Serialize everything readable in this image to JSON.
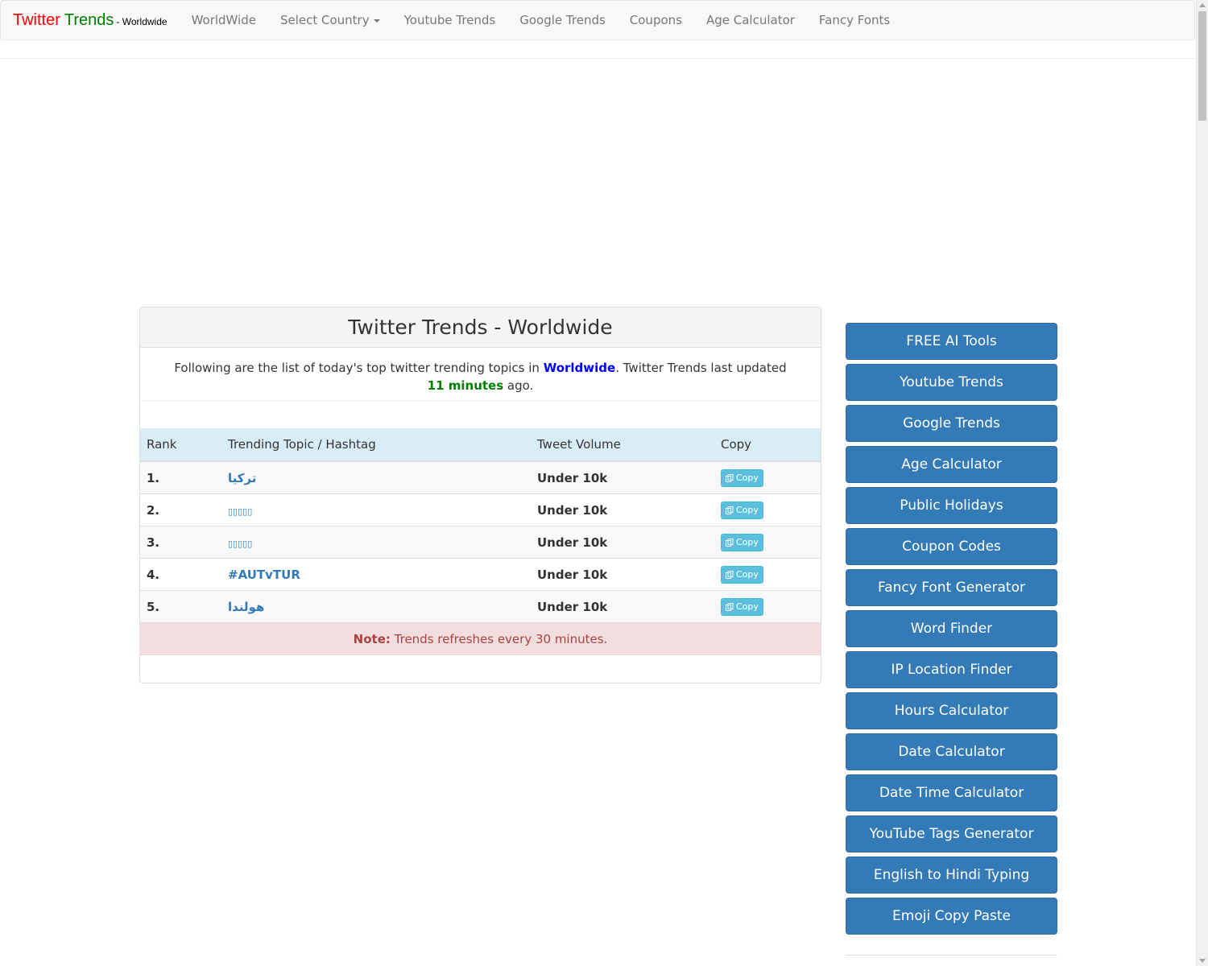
{
  "navbar": {
    "brand_part1": "Twitter",
    "brand_part2": "Trends",
    "brand_suffix": "- Worldwide",
    "items": [
      "WorldWide",
      "Select Country",
      "Youtube Trends",
      "Google Trends",
      "Coupons",
      "Age Calculator",
      "Fancy Fonts"
    ]
  },
  "panel": {
    "title": "Twitter Trends - Worldwide",
    "intro_pre": "Following are the list of today's top twitter trending topics in ",
    "intro_country": "Worldwide",
    "intro_mid": ". Twitter Trends last updated ",
    "intro_updated": "11 minutes",
    "intro_post": " ago."
  },
  "table": {
    "headers": [
      "Rank",
      "Trending Topic / Hashtag",
      "Tweet Volume",
      "Copy"
    ],
    "rows": [
      {
        "rank": "1.",
        "topic": "تركيا",
        "volume": "Under 10k",
        "copy": "Copy"
      },
      {
        "rank": "2.",
        "topic": "▯▯▯▯▯",
        "volume": "Under 10k",
        "copy": "Copy"
      },
      {
        "rank": "3.",
        "topic": "▯▯▯▯▯",
        "volume": "Under 10k",
        "copy": "Copy"
      },
      {
        "rank": "4.",
        "topic": "#AUTvTUR",
        "volume": "Under 10k",
        "copy": "Copy"
      },
      {
        "rank": "5.",
        "topic": "هولندا",
        "volume": "Under 10k",
        "copy": "Copy"
      }
    ],
    "note_label": "Note:",
    "note_text": " Trends refreshes every 30 minutes."
  },
  "sidebar": {
    "buttons": [
      "FREE AI Tools",
      "Youtube Trends",
      "Google Trends",
      "Age Calculator",
      "Public Holidays",
      "Coupon Codes",
      "Fancy Font Generator",
      "Word Finder",
      "IP Location Finder",
      "Hours Calculator",
      "Date Calculator",
      "Date Time Calculator",
      "YouTube Tags Generator",
      "English to Hindi Typing",
      "Emoji Copy Paste"
    ]
  },
  "colors": {
    "brand_red": "#ff0000",
    "brand_green": "#008000",
    "primary_button": "#337ab7",
    "table_header": "#d9edf7",
    "copy_button": "#5bc0de",
    "note_bg": "#f2dede",
    "note_text": "#a94442"
  },
  "icons": {
    "copy": "copy-icon",
    "dropdown": "caret-down-icon"
  }
}
